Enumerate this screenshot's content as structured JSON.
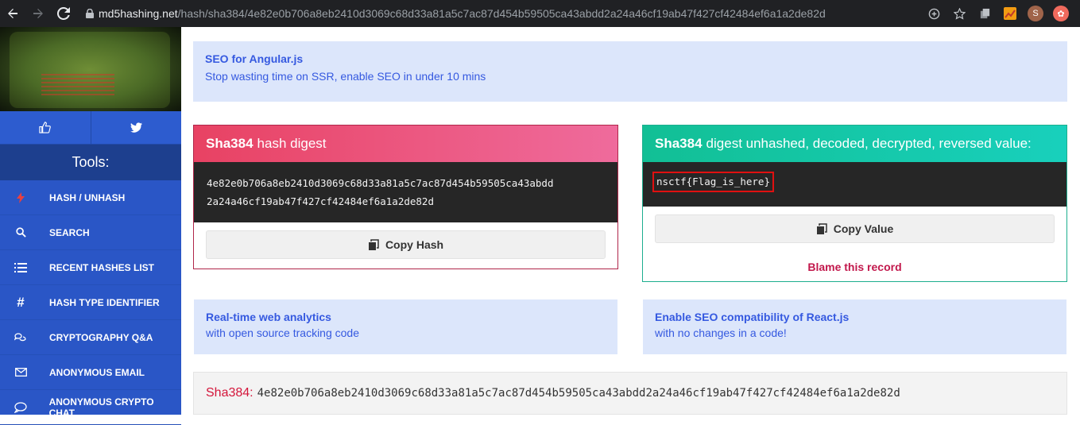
{
  "browser": {
    "url_host": "md5hashing.net",
    "url_path": "/hash/sha384/4e82e0b706a8eb2410d3069c68d33a81a5c7ac87d454b59505ca43abdd2a24a46cf19ab47f427cf42484ef6a1a2de82d",
    "avatar_letter": "S"
  },
  "sidebar": {
    "tools_title": "Tools:",
    "items": [
      {
        "label": "HASH / UNHASH",
        "icon": "lightning-icon"
      },
      {
        "label": "SEARCH",
        "icon": "search-icon"
      },
      {
        "label": "RECENT HASHES LIST",
        "icon": "list-icon"
      },
      {
        "label": "HASH TYPE IDENTIFIER",
        "icon": "hashtag-icon"
      },
      {
        "label": "CRYPTOGRAPHY Q&A",
        "icon": "chat-bubbles-icon"
      },
      {
        "label": "ANONYMOUS EMAIL",
        "icon": "envelope-icon"
      },
      {
        "label": "ANONYMOUS CRYPTO CHAT",
        "icon": "speech-bubble-icon"
      }
    ]
  },
  "ads": {
    "top": {
      "title": "SEO for Angular.js",
      "sub": "Stop wasting time on SSR, enable SEO in under 10 mins"
    },
    "left": {
      "title": "Real-time web analytics",
      "sub": "with open source tracking code"
    },
    "right": {
      "title": "Enable SEO compatibility of React.js",
      "sub": "with no changes in a code!"
    }
  },
  "digest_card": {
    "algo": "Sha384",
    "title_rest": "hash digest",
    "hash_line1": "4e82e0b706a8eb2410d3069c68d33a81a5c7ac87d454b59505ca43abdd",
    "hash_line2": "2a24a46cf19ab47f427cf42484ef6a1a2de82d",
    "copy_label": "Copy Hash"
  },
  "value_card": {
    "algo": "Sha384",
    "title_rest": "digest unhashed, decoded, decrypted, reversed value:",
    "value": "nsctf{Flag_is_here}",
    "copy_label": "Copy Value",
    "blame_label": "Blame this record"
  },
  "bottom": {
    "label": "Sha384:",
    "hash": "4e82e0b706a8eb2410d3069c68d33a81a5c7ac87d454b59505ca43abdd2a24a46cf19ab47f427cf42484ef6a1a2de82d"
  },
  "colors": {
    "sidebar": "#2a56c6",
    "digest_accent": "#e84263",
    "value_accent": "#12bf95",
    "ad_bg": "#dce6fb"
  }
}
